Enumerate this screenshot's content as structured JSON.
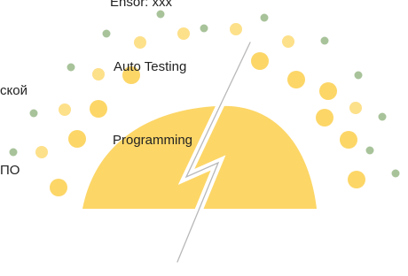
{
  "labels": {
    "top": "Ensor:      xxx",
    "left_1": "ской",
    "left_2": "ПО",
    "auto_testing": "Auto Testing",
    "programming": "Programming"
  },
  "colors": {
    "sun": "#fcd667",
    "dot_yellow": "#fde08a",
    "dot_green": "#a8c39a",
    "dot_grey": "#b6c9b0",
    "bolt_outline": "#b8b8b8"
  },
  "icons": {
    "central_shape": "sun-dome",
    "stroke": "lightning-bolt-icon"
  }
}
